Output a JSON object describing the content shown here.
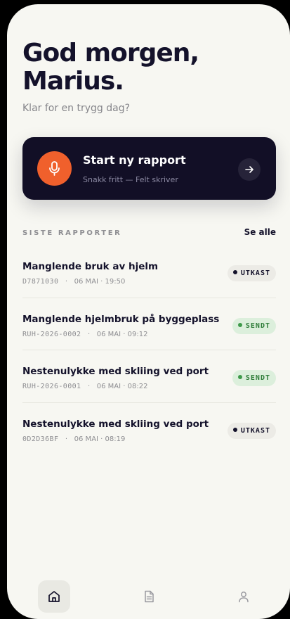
{
  "greeting": {
    "line1": "God morgen,",
    "line2": "Marius."
  },
  "subtitle": "Klar for en trygg dag?",
  "cta": {
    "icon": "microphone-icon",
    "title": "Start ny rapport",
    "subtitle": "Snakk fritt — Felt skriver",
    "accent": "#f0602c"
  },
  "recent": {
    "label": "SISTE RAPPORTER",
    "see_all": "Se alle",
    "items": [
      {
        "title": "Manglende bruk av hjelm",
        "id": "D7871030",
        "sep": "·",
        "time": "06 MAI · 19:50",
        "status": "UTKAST",
        "status_kind": "draft"
      },
      {
        "title": "Manglende hjelmbruk på byggeplass",
        "id": "RUH-2026-0002",
        "sep": "·",
        "time": "06 MAI · 09:12",
        "status": "SENDT",
        "status_kind": "sent"
      },
      {
        "title": "Nestenulykke med skliing ved port",
        "id": "RUH-2026-0001",
        "sep": "·",
        "time": "06 MAI · 08:22",
        "status": "SENDT",
        "status_kind": "sent"
      },
      {
        "title": "Nestenulykke med skliing ved port",
        "id": "0D2D36BF",
        "sep": "·",
        "time": "06 MAI · 08:19",
        "status": "UTKAST",
        "status_kind": "draft"
      }
    ]
  },
  "tabbar": {
    "tabs": [
      {
        "icon": "home-icon",
        "active": true
      },
      {
        "icon": "document-icon",
        "active": false
      },
      {
        "icon": "profile-icon",
        "active": false
      }
    ]
  },
  "colors": {
    "background": "#f7f7f2",
    "ink": "#14122b",
    "cta_background": "#120f26",
    "sent": "#2f7d3a",
    "sent_background": "#dcefdc"
  }
}
